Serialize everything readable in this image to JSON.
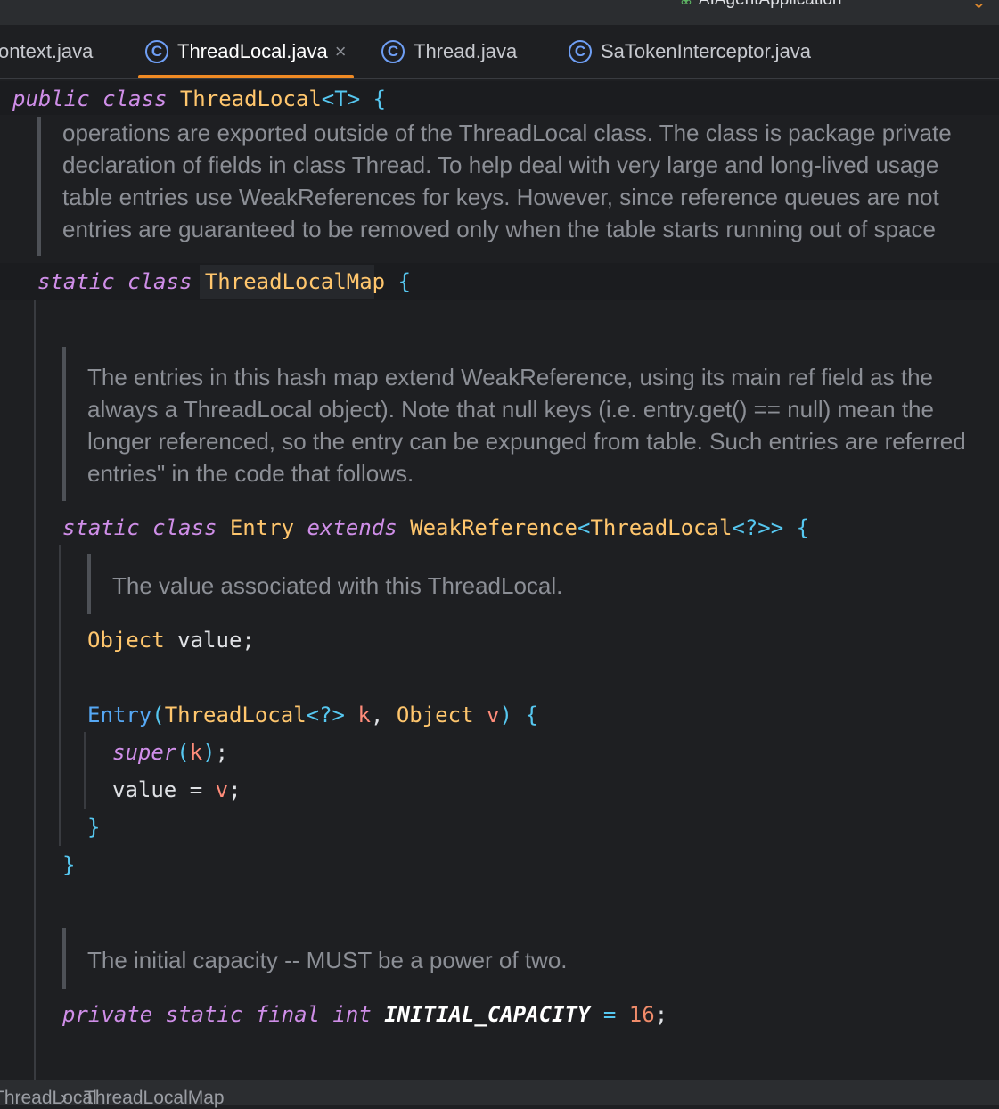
{
  "window": {
    "run_configuration": "AIAgentApplication"
  },
  "tabs": [
    {
      "label": "ontext.java",
      "active": false
    },
    {
      "label": "ThreadLocal.java",
      "active": true
    },
    {
      "label": "Thread.java",
      "active": false
    },
    {
      "label": "SaTokenInterceptor.java",
      "active": false
    }
  ],
  "code": {
    "class_decl": {
      "modifiers": "public class",
      "name": "ThreadLocal",
      "generic": "<T>",
      "brace": "{"
    },
    "doc1": [
      "operations are exported outside of the ThreadLocal class. The class is package private",
      "declaration of fields in class Thread. To help deal with very large and long-lived usage",
      "table entries use WeakReferences for keys. However, since reference queues are not",
      "entries are guaranteed to be removed only when the table starts running out of space"
    ],
    "map_decl": {
      "modifiers": "static class",
      "name": "ThreadLocalMap",
      "brace": "{"
    },
    "doc2": [
      "The entries in this hash map extend WeakReference, using its main ref field as the",
      "always a ThreadLocal object). Note that null keys (i.e. entry.get() == null) mean the",
      "longer referenced, so the entry can be expunged from table. Such entries are referred",
      "entries\" in the code that follows."
    ],
    "entry_decl": {
      "modifiers": "static class",
      "name": "Entry",
      "extends_kw": "extends",
      "super_type": "WeakReference",
      "lt": "<",
      "type_arg": "ThreadLocal",
      "wildcard": "<?>>",
      "brace": "{"
    },
    "doc3": "The value associated with this ThreadLocal.",
    "field": {
      "type": "Object",
      "name": "value",
      "semi": ";"
    },
    "ctor": {
      "name": "Entry",
      "open": "(",
      "p1_type": "ThreadLocal",
      "p1_generic": "<?>",
      "p1_name": "k",
      "comma": ",",
      "p2_type": "Object",
      "p2_name": "v",
      "close": ")",
      "brace": "{"
    },
    "super_call": {
      "kw": "super",
      "open": "(",
      "arg": "k",
      "close": ")",
      "semi": ";"
    },
    "assign": {
      "lhs": "value",
      "op": "=",
      "rhs": "v",
      "semi": ";"
    },
    "close_inner": "}",
    "close_entry": "}",
    "doc4": "The initial capacity -- MUST be a power of two.",
    "const_decl": {
      "modifiers": "private static final int",
      "name": "INITIAL_CAPACITY",
      "op": "=",
      "value": "16",
      "semi": ";"
    }
  },
  "breadcrumb": {
    "items": [
      "ThreadLocal",
      "ThreadLocalMap"
    ],
    "separator": "›"
  }
}
